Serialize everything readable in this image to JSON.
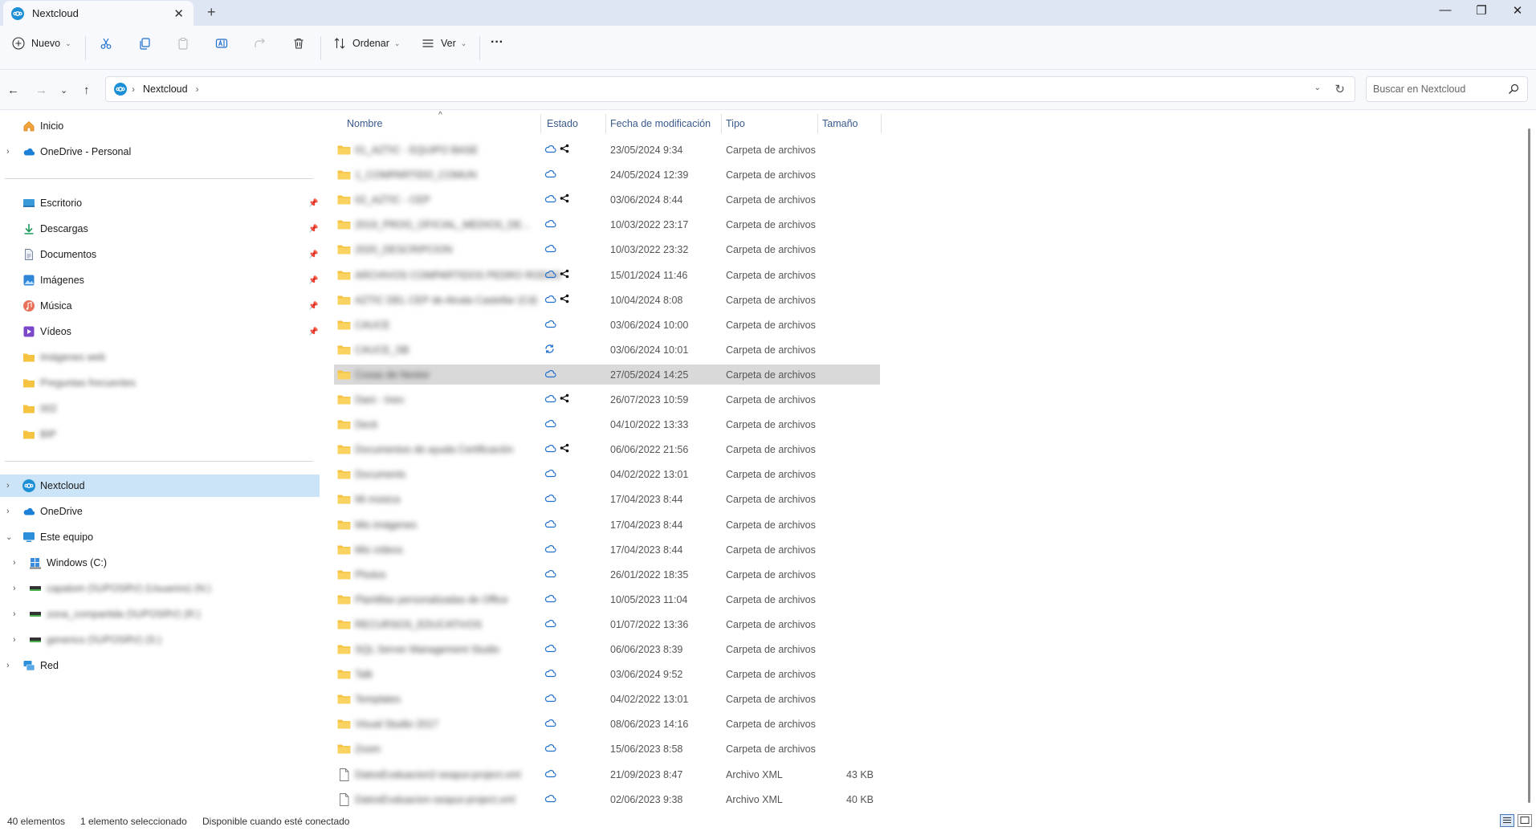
{
  "window": {
    "tab_title": "Nextcloud",
    "tab_close_icon": "close-icon",
    "new_tab_icon": "plus-icon"
  },
  "toolbar": {
    "new_label": "Nuevo",
    "sort_label": "Ordenar",
    "view_label": "Ver",
    "more_label": "···"
  },
  "address": {
    "crumbs": [
      "Nextcloud"
    ],
    "search_placeholder": "Buscar en Nextcloud"
  },
  "sidebar": {
    "home": "Inicio",
    "onedrive_personal": "OneDrive - Personal",
    "pinned": [
      "Escritorio",
      "Descargas",
      "Documentos",
      "Imágenes",
      "Música",
      "Vídeos"
    ],
    "recent_folders": [
      "Imágenes web",
      "Preguntas frecuentes",
      "002",
      "BIP"
    ],
    "nextcloud": "Nextcloud",
    "onedrive": "OneDrive",
    "this_pc": "Este equipo",
    "drives": [
      "Windows (C:)",
      "capatom (\\\\UPOSRV) (Usuarios) (N:)",
      "zona_compartida (\\\\UPOSRV) (R:)",
      "generico (\\\\UPOSRV) (S:)"
    ],
    "network": "Red"
  },
  "columns": {
    "name": "Nombre",
    "state": "Estado",
    "modified": "Fecha de modificación",
    "type": "Tipo",
    "size": "Tamaño"
  },
  "files": [
    {
      "name": "01_AZTIC - EQUIPO BASE",
      "state": "cloud-shared",
      "date": "23/05/2024 9:34",
      "type": "Carpeta de archivos",
      "size": "",
      "icon": "folder"
    },
    {
      "name": "1_COMPARTIDO_COMUN",
      "state": "cloud",
      "date": "24/05/2024 12:39",
      "type": "Carpeta de archivos",
      "size": "",
      "icon": "folder"
    },
    {
      "name": "02_AZTIC - CEP",
      "state": "cloud-shared",
      "date": "03/06/2024 8:44",
      "type": "Carpeta de archivos",
      "size": "",
      "icon": "folder"
    },
    {
      "name": "2019_PROG_OFICIAL_MEDIOS_DE...",
      "state": "cloud",
      "date": "10/03/2022 23:17",
      "type": "Carpeta de archivos",
      "size": "",
      "icon": "folder"
    },
    {
      "name": "2020_DESCRIPCION",
      "state": "cloud",
      "date": "10/03/2022 23:32",
      "type": "Carpeta de archivos",
      "size": "",
      "icon": "folder"
    },
    {
      "name": "ARCHIVOS COMPARTIDOS PEDRO RODAS",
      "state": "cloud-shared",
      "date": "15/01/2024 11:46",
      "type": "Carpeta de archivos",
      "size": "",
      "icon": "folder"
    },
    {
      "name": "AZTIC DEL CEP de Alcala Castellar (Cd)",
      "state": "cloud-shared",
      "date": "10/04/2024 8:08",
      "type": "Carpeta de archivos",
      "size": "",
      "icon": "folder"
    },
    {
      "name": "CAUCE",
      "state": "cloud",
      "date": "03/06/2024 10:00",
      "type": "Carpeta de archivos",
      "size": "",
      "icon": "folder"
    },
    {
      "name": "CAUCE_SB",
      "state": "sync",
      "date": "03/06/2024 10:01",
      "type": "Carpeta de archivos",
      "size": "",
      "icon": "folder"
    },
    {
      "name": "Cosas de Nestor",
      "state": "cloud",
      "date": "27/05/2024 14:25",
      "type": "Carpeta de archivos",
      "size": "",
      "icon": "folder",
      "selected": true
    },
    {
      "name": "Dani - Ineo",
      "state": "cloud-shared",
      "date": "26/07/2023 10:59",
      "type": "Carpeta de archivos",
      "size": "",
      "icon": "folder"
    },
    {
      "name": "Deck",
      "state": "cloud",
      "date": "04/10/2022 13:33",
      "type": "Carpeta de archivos",
      "size": "",
      "icon": "folder"
    },
    {
      "name": "Documentos de ayuda Certificación",
      "state": "cloud-shared",
      "date": "06/06/2022 21:56",
      "type": "Carpeta de archivos",
      "size": "",
      "icon": "folder"
    },
    {
      "name": "Documents",
      "state": "cloud",
      "date": "04/02/2022 13:01",
      "type": "Carpeta de archivos",
      "size": "",
      "icon": "folder"
    },
    {
      "name": "Mi música",
      "state": "cloud",
      "date": "17/04/2023 8:44",
      "type": "Carpeta de archivos",
      "size": "",
      "icon": "folder"
    },
    {
      "name": "Mis imágenes",
      "state": "cloud",
      "date": "17/04/2023 8:44",
      "type": "Carpeta de archivos",
      "size": "",
      "icon": "folder"
    },
    {
      "name": "Mis vídeos",
      "state": "cloud",
      "date": "17/04/2023 8:44",
      "type": "Carpeta de archivos",
      "size": "",
      "icon": "folder"
    },
    {
      "name": "Photos",
      "state": "cloud",
      "date": "26/01/2022 18:35",
      "type": "Carpeta de archivos",
      "size": "",
      "icon": "folder"
    },
    {
      "name": "Plantillas personalizadas de Office",
      "state": "cloud",
      "date": "10/05/2023 11:04",
      "type": "Carpeta de archivos",
      "size": "",
      "icon": "folder"
    },
    {
      "name": "RECURSOS_EDUCATIVOS",
      "state": "cloud",
      "date": "01/07/2022 13:36",
      "type": "Carpeta de archivos",
      "size": "",
      "icon": "folder"
    },
    {
      "name": "SQL Server Management Studio",
      "state": "cloud",
      "date": "06/06/2023 8:39",
      "type": "Carpeta de archivos",
      "size": "",
      "icon": "folder"
    },
    {
      "name": "Talk",
      "state": "cloud",
      "date": "03/06/2024 9:52",
      "type": "Carpeta de archivos",
      "size": "",
      "icon": "folder"
    },
    {
      "name": "Templates",
      "state": "cloud",
      "date": "04/02/2022 13:01",
      "type": "Carpeta de archivos",
      "size": "",
      "icon": "folder"
    },
    {
      "name": "Visual Studio 2017",
      "state": "cloud",
      "date": "08/06/2023 14:16",
      "type": "Carpeta de archivos",
      "size": "",
      "icon": "folder"
    },
    {
      "name": "Zoom",
      "state": "cloud",
      "date": "15/06/2023 8:58",
      "type": "Carpeta de archivos",
      "size": "",
      "icon": "folder"
    },
    {
      "name": "DatosEvaluacion2-seapui-project.xml",
      "state": "cloud",
      "date": "21/09/2023 8:47",
      "type": "Archivo XML",
      "size": "43 KB",
      "icon": "file"
    },
    {
      "name": "DatosEvaluacion-seapui-project.xml",
      "state": "cloud",
      "date": "02/06/2023 9:38",
      "type": "Archivo XML",
      "size": "40 KB",
      "icon": "file"
    }
  ],
  "status": {
    "count": "40 elementos",
    "selected": "1 elemento seleccionado",
    "availability": "Disponible cuando esté conectado"
  },
  "colors": {
    "accent": "#1f6fd0",
    "folder": "#f5c242",
    "selected_nav": "#cce4f7",
    "selected_row": "#d9d9d9",
    "nextcloud": "#1d8fd7"
  }
}
